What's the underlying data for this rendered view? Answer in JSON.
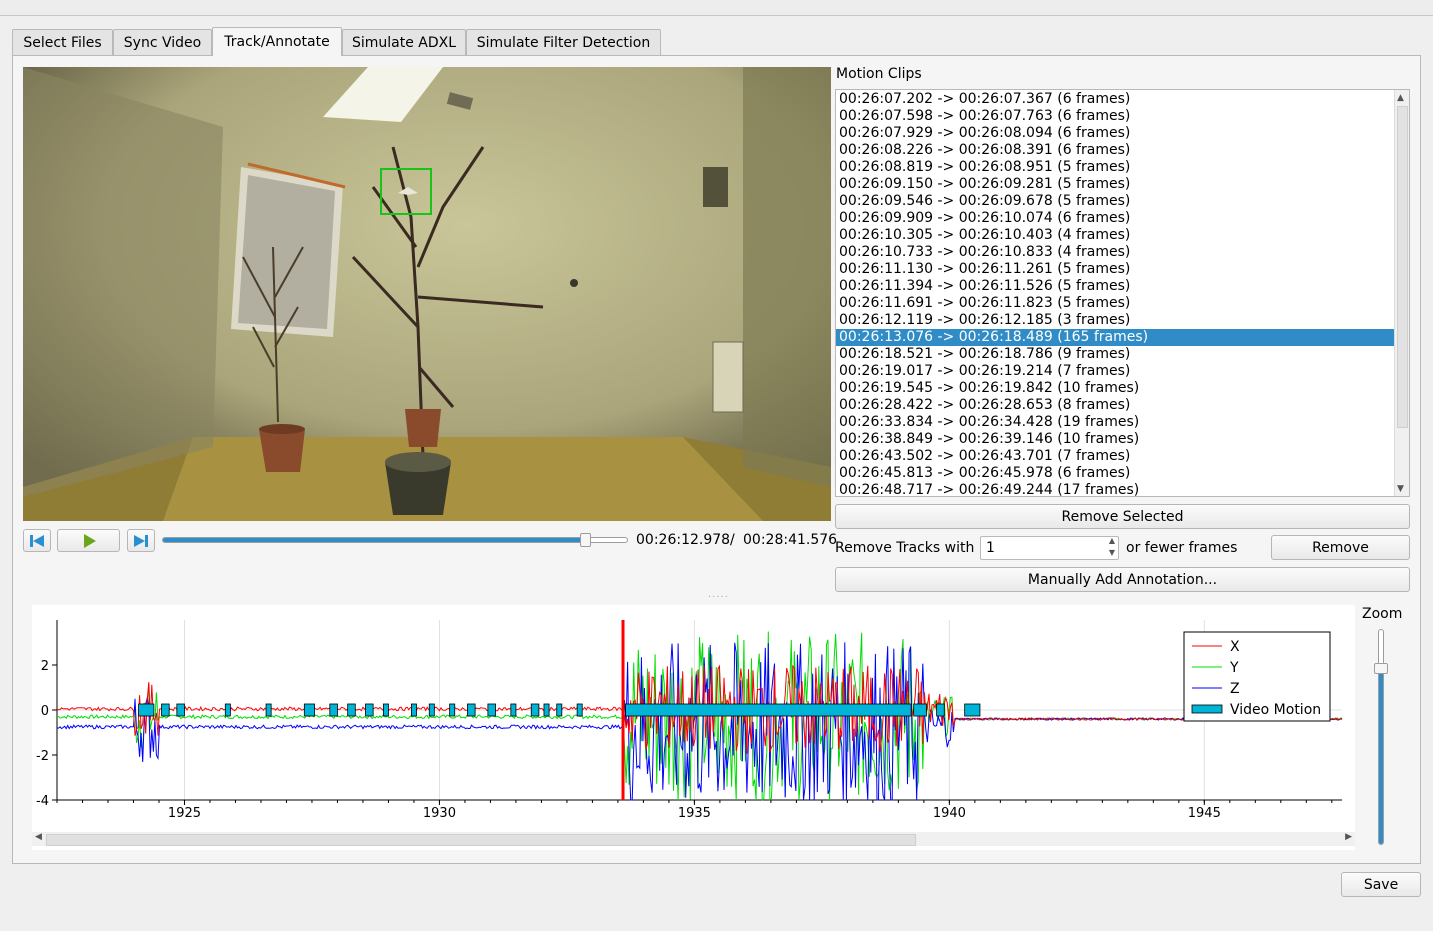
{
  "tabs": [
    {
      "label": "Select Files"
    },
    {
      "label": "Sync Video"
    },
    {
      "label": "Track/Annotate"
    },
    {
      "label": "Simulate ADXL"
    },
    {
      "label": "Simulate Filter Detection"
    }
  ],
  "active_tab": "Track/Annotate",
  "player": {
    "current_time": "00:26:12.978",
    "separator": "/",
    "total_time": "00:28:41.576",
    "progress_fraction": 0.91,
    "icons": [
      "skip-back-icon",
      "play-icon",
      "skip-forward-icon"
    ]
  },
  "clips": {
    "label": "Motion Clips",
    "items": [
      "00:26:07.202 -> 00:26:07.367 (6 frames)",
      "00:26:07.598 -> 00:26:07.763 (6 frames)",
      "00:26:07.929 -> 00:26:08.094 (6 frames)",
      "00:26:08.226 -> 00:26:08.391 (6 frames)",
      "00:26:08.819 -> 00:26:08.951 (5 frames)",
      "00:26:09.150 -> 00:26:09.281 (5 frames)",
      "00:26:09.546 -> 00:26:09.678 (5 frames)",
      "00:26:09.909 -> 00:26:10.074 (6 frames)",
      "00:26:10.305 -> 00:26:10.403 (4 frames)",
      "00:26:10.733 -> 00:26:10.833 (4 frames)",
      "00:26:11.130 -> 00:26:11.261 (5 frames)",
      "00:26:11.394 -> 00:26:11.526 (5 frames)",
      "00:26:11.691 -> 00:26:11.823 (5 frames)",
      "00:26:12.119 -> 00:26:12.185 (3 frames)",
      "00:26:13.076 -> 00:26:18.489 (165 frames)",
      "00:26:18.521 -> 00:26:18.786 (9 frames)",
      "00:26:19.017 -> 00:26:19.214 (7 frames)",
      "00:26:19.545 -> 00:26:19.842 (10 frames)",
      "00:26:28.422 -> 00:26:28.653 (8 frames)",
      "00:26:33.834 -> 00:26:34.428 (19 frames)",
      "00:26:38.849 -> 00:26:39.146 (10 frames)",
      "00:26:43.502 -> 00:26:43.701 (7 frames)",
      "00:26:45.813 -> 00:26:45.978 (6 frames)",
      "00:26:48.717 -> 00:26:49.244 (17 frames)"
    ],
    "selected_index": 14
  },
  "controls": {
    "remove_selected": "Remove Selected",
    "remove_tracks_prefix": "Remove Tracks with",
    "remove_tracks_value": "1",
    "remove_tracks_suffix": "or fewer frames",
    "remove": "Remove",
    "manual_add": "Manually Add Annotation..."
  },
  "zoom": {
    "label": "Zoom",
    "level_fraction": 0.82
  },
  "save": "Save",
  "chart_data": {
    "type": "line",
    "x_ticks": [
      1925,
      1930,
      1935,
      1940,
      1945
    ],
    "y_ticks": [
      2,
      0,
      -2,
      -4
    ],
    "xlim": [
      1922.5,
      1947.7
    ],
    "ylim": [
      -4,
      4
    ],
    "series": [
      {
        "name": "X",
        "color": "#ff0000"
      },
      {
        "name": "Y",
        "color": "#00dd00"
      },
      {
        "name": "Z",
        "color": "#0000ff"
      },
      {
        "name": "Video Motion",
        "color": "#00b4d8"
      }
    ],
    "video_motion_intervals": [
      [
        1924.1,
        1924.4
      ],
      [
        1924.55,
        1924.7
      ],
      [
        1924.85,
        1925.0
      ],
      [
        1925.8,
        1925.9
      ],
      [
        1926.6,
        1926.7
      ],
      [
        1927.35,
        1927.55
      ],
      [
        1927.85,
        1928.0
      ],
      [
        1928.2,
        1928.35
      ],
      [
        1928.55,
        1928.7
      ],
      [
        1928.9,
        1929.0
      ],
      [
        1929.45,
        1929.55
      ],
      [
        1929.8,
        1929.9
      ],
      [
        1930.2,
        1930.3
      ],
      [
        1930.55,
        1930.7
      ],
      [
        1930.95,
        1931.1
      ],
      [
        1931.4,
        1931.5
      ],
      [
        1931.8,
        1931.95
      ],
      [
        1932.05,
        1932.15
      ],
      [
        1932.3,
        1932.4
      ],
      [
        1932.7,
        1932.8
      ],
      [
        1933.65,
        1939.25
      ],
      [
        1939.3,
        1939.55
      ],
      [
        1939.75,
        1939.9
      ],
      [
        1940.3,
        1940.6
      ]
    ],
    "marker_x": 1933.6
  }
}
